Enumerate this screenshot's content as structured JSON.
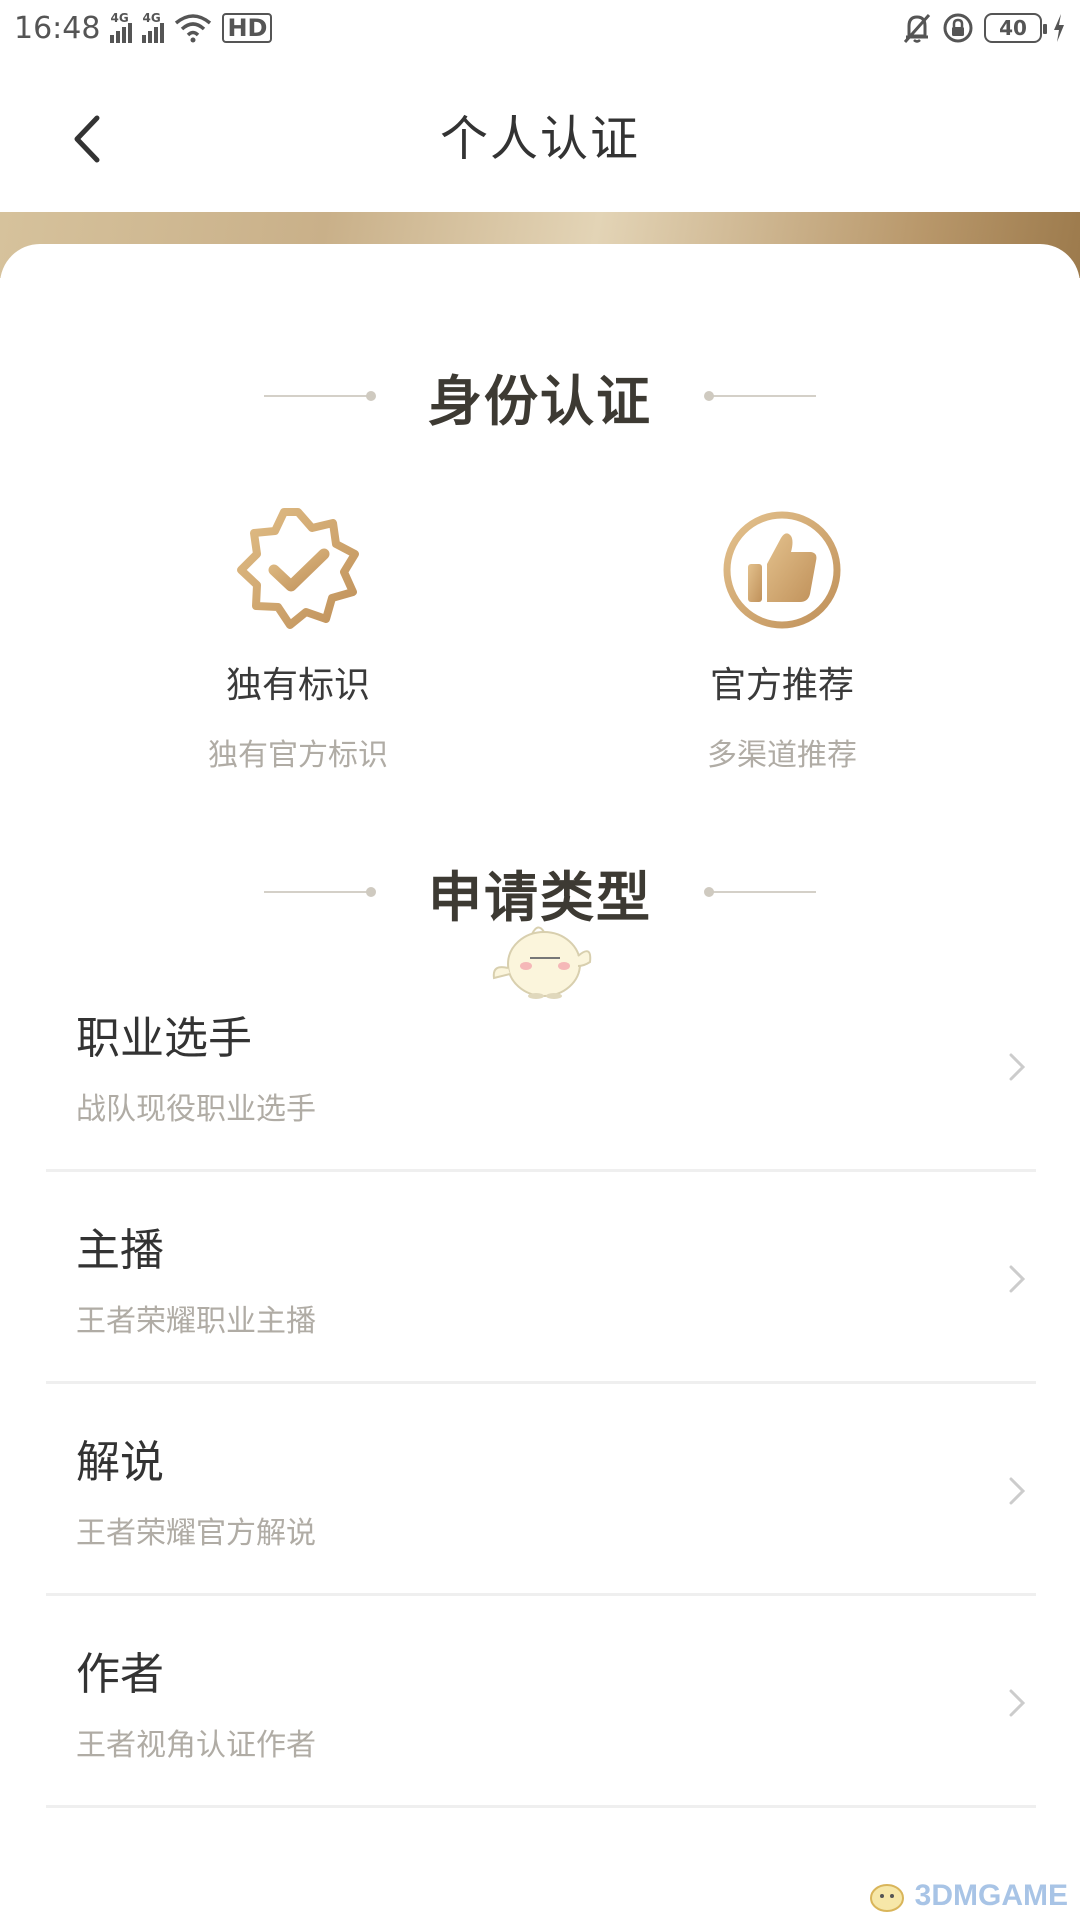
{
  "status_bar": {
    "time": "16:48",
    "network_1": "4G",
    "network_2": "4G",
    "hd_label": "HD",
    "battery": "40"
  },
  "nav": {
    "title": "个人认证"
  },
  "identity_section": {
    "heading": "身份认证",
    "features": [
      {
        "title": "独有标识",
        "subtitle": "独有官方标识",
        "icon": "verified-badge-icon"
      },
      {
        "title": "官方推荐",
        "subtitle": "多渠道推荐",
        "icon": "thumbs-up-icon"
      }
    ]
  },
  "apply_section": {
    "heading": "申请类型",
    "items": [
      {
        "title": "职业选手",
        "subtitle": "战队现役职业选手"
      },
      {
        "title": "主播",
        "subtitle": "王者荣耀职业主播"
      },
      {
        "title": "解说",
        "subtitle": "王者荣耀官方解说"
      },
      {
        "title": "作者",
        "subtitle": "王者视角认证作者"
      }
    ]
  },
  "watermark": "3DMGAME",
  "colors": {
    "gold": "#c9a46a",
    "gold_dark": "#b98c4e",
    "text_primary": "#333333",
    "text_secondary": "#b0aca5",
    "divider": "#efefef"
  }
}
